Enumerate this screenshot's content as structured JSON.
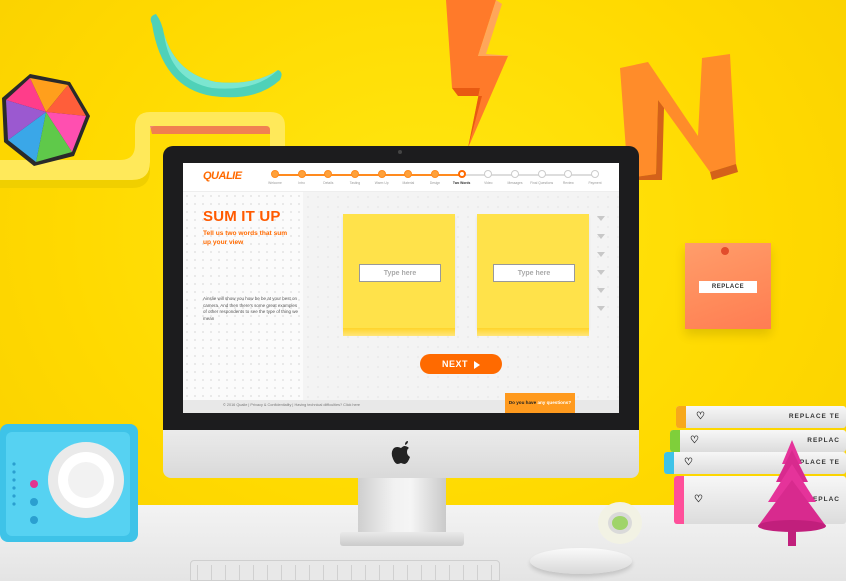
{
  "app": {
    "logo": "QUALIE"
  },
  "progress": {
    "steps": [
      {
        "label": "Welcome",
        "state": "done"
      },
      {
        "label": "Intro",
        "state": "done"
      },
      {
        "label": "Details",
        "state": "done"
      },
      {
        "label": "Tasting",
        "state": "done"
      },
      {
        "label": "Warm Up",
        "state": "done"
      },
      {
        "label": "Material",
        "state": "done"
      },
      {
        "label": "Design",
        "state": "done"
      },
      {
        "label": "Two Words",
        "state": "current"
      },
      {
        "label": "Video",
        "state": "todo"
      },
      {
        "label": "Messages",
        "state": "todo"
      },
      {
        "label": "Final Questions",
        "state": "todo"
      },
      {
        "label": "Review",
        "state": "todo"
      },
      {
        "label": "Payment",
        "state": "todo"
      }
    ]
  },
  "left": {
    "title": "SUM IT UP",
    "subtitle": "Tell us two words that sum up your view",
    "description": "Ainslie will show you how be be at your best on camera. And then there's some great examples of other respondents to see the type of thing we mean"
  },
  "cards": [
    {
      "placeholder": "Type here"
    },
    {
      "placeholder": "Type here"
    }
  ],
  "next_label": "NEXT",
  "footer": {
    "text": "© 2016 Qualie | Privacy & Confidentiality | Having technical difficulties? Click here",
    "questions_prefix": "Do you have ",
    "questions_highlight": "any questions?"
  },
  "props": {
    "wall_note_label": "REPLACE",
    "books": [
      "REPLACE TE",
      "REPLAC",
      "REPLACE TE",
      "REPLAC"
    ]
  },
  "colors": {
    "accent": "#ff6a00",
    "background": "#ffdd00",
    "note": "#ffe24a"
  }
}
